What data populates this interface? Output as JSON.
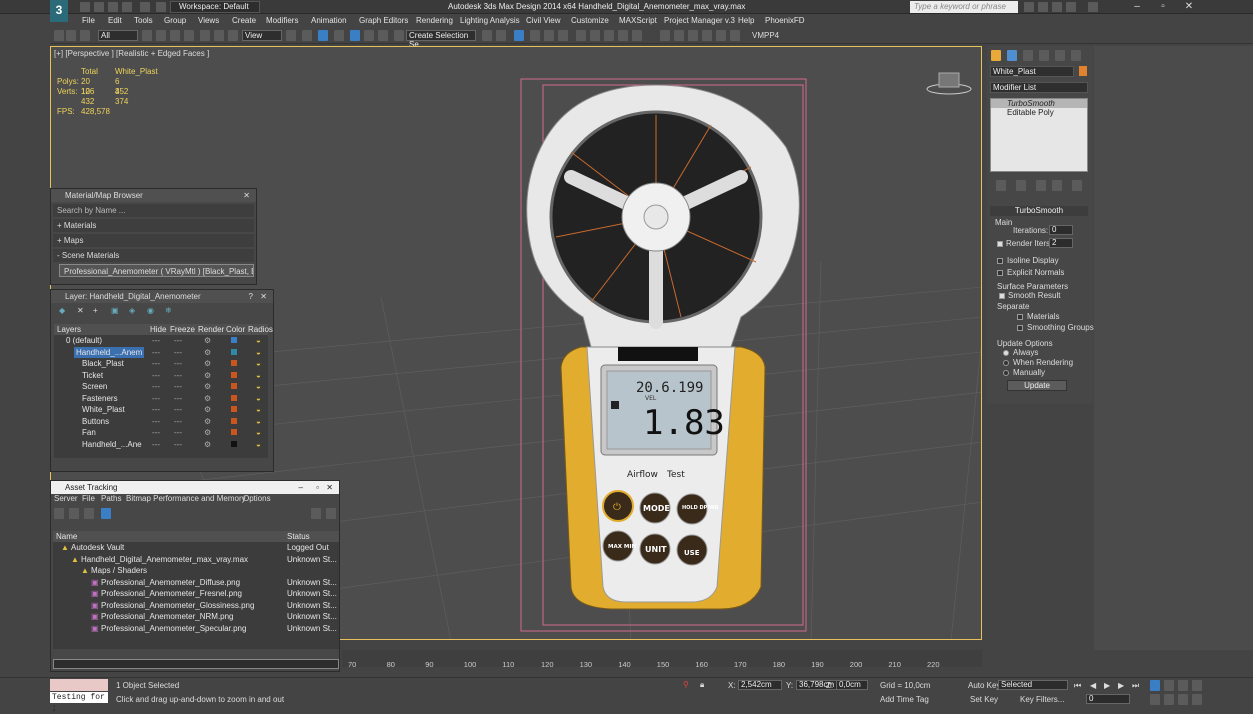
{
  "app": {
    "title": "Autodesk 3ds Max Design 2014 x64     Handheld_Digital_Anemometer_max_vray.max",
    "workspace": "Workspace: Default",
    "search_placeholder": "Type a keyword or phrase"
  },
  "menu": [
    "File",
    "Edit",
    "Tools",
    "Group",
    "Views",
    "Create",
    "Modifiers",
    "Animation",
    "Graph Editors",
    "Rendering",
    "Lighting Analysis",
    "Civil View",
    "Customize",
    "MAXScript",
    "Project Manager v.3",
    "Help",
    "PhoenixFD"
  ],
  "toolbar": {
    "filter": "All",
    "ref_coord": "View",
    "selection_set": "Create Selection Se",
    "vmpp": "VMPP4"
  },
  "viewport": {
    "label": "[+] [Perspective ] [Realistic + Edged Faces ]",
    "stats": {
      "h_total": "Total",
      "h_obj": "White_Plast",
      "polys_label": "Polys:",
      "polys_total": "20 126",
      "polys_obj": "6 452",
      "verts_label": "Verts:",
      "verts_total": "10 432",
      "verts_obj": "3 374",
      "fps_label": "FPS:",
      "fps": "428,578"
    },
    "device": {
      "lcd_top": "20.6.199",
      "lcd_unit": "VEL",
      "lcd_main": "1.83",
      "airflow": "Airflow",
      "test": "Test",
      "buttons": [
        "MODE",
        "HOLD DP/WB",
        "MAX MIN",
        "UNIT",
        "USE"
      ]
    }
  },
  "material_browser": {
    "title": "Material/Map Browser",
    "search": "Search by Name ...",
    "sections": [
      "+ Materials",
      "+ Maps",
      "- Scene Materials"
    ],
    "scene_material": "Professional_Anemometer ( VRayMtl ) [Black_Plast, B..."
  },
  "layer_manager": {
    "title": "Layer: Handheld_Digital_Anemometer",
    "columns": [
      "Layers",
      "Hide",
      "Freeze",
      "Render",
      "Color",
      "Radios"
    ],
    "rows": [
      {
        "name": "0 (default)",
        "color": "#3a7fc6",
        "indent": 0
      },
      {
        "name": "Handheld_...Anem",
        "color": "#2e8aa8",
        "indent": 1,
        "selected": true
      },
      {
        "name": "Black_Plast",
        "color": "#c8561e",
        "indent": 2
      },
      {
        "name": "Ticket",
        "color": "#c8561e",
        "indent": 2
      },
      {
        "name": "Screen",
        "color": "#c8561e",
        "indent": 2
      },
      {
        "name": "Fasteners",
        "color": "#c8561e",
        "indent": 2
      },
      {
        "name": "White_Plast",
        "color": "#c8561e",
        "indent": 2
      },
      {
        "name": "Buttons",
        "color": "#c8561e",
        "indent": 2
      },
      {
        "name": "Fan",
        "color": "#c8561e",
        "indent": 2
      },
      {
        "name": "Handheld_...Ane",
        "color": "#111111",
        "indent": 2
      }
    ]
  },
  "asset_tracking": {
    "title": "Asset Tracking",
    "menu": [
      "Server",
      "File",
      "Paths",
      "Bitmap Performance and Memory",
      "Options"
    ],
    "col_name": "Name",
    "col_status": "Status",
    "rows": [
      {
        "name": "Autodesk Vault",
        "status": "Logged Out",
        "indent": 0
      },
      {
        "name": "Handheld_Digital_Anemometer_max_vray.max",
        "status": "Unknown St...",
        "indent": 1
      },
      {
        "name": "Maps / Shaders",
        "status": "",
        "indent": 2
      },
      {
        "name": "Professional_Anemometer_Diffuse.png",
        "status": "Unknown St...",
        "indent": 3
      },
      {
        "name": "Professional_Anemometer_Fresnel.png",
        "status": "Unknown St...",
        "indent": 3
      },
      {
        "name": "Professional_Anemometer_Glossiness.png",
        "status": "Unknown St...",
        "indent": 3
      },
      {
        "name": "Professional_Anemometer_NRM.png",
        "status": "Unknown St...",
        "indent": 3
      },
      {
        "name": "Professional_Anemometer_Specular.png",
        "status": "Unknown St...",
        "indent": 3
      }
    ]
  },
  "command_panel": {
    "object_name": "White_Plast",
    "modifier_list": "Modifier List",
    "stack": [
      "TurboSmooth",
      "Editable Poly"
    ],
    "turbosmooth": {
      "title": "TurboSmooth",
      "main": "Main",
      "iterations_label": "Iterations:",
      "iterations": "0",
      "render_iters_label": "Render Iters:",
      "render_iters": "2",
      "isoline": "Isoline Display",
      "explicit": "Explicit Normals",
      "surface": "Surface Parameters",
      "smooth_result": "Smooth Result",
      "separate": "Separate",
      "materials": "Materials",
      "smoothing_groups": "Smoothing Groups",
      "update_options": "Update Options",
      "always": "Always",
      "when_rendering": "When Rendering",
      "manually": "Manually",
      "update_btn": "Update"
    }
  },
  "timeline": {
    "ticks": [
      "70",
      "80",
      "90",
      "100",
      "110",
      "120",
      "130",
      "140",
      "150",
      "160",
      "170",
      "180",
      "190",
      "200",
      "210",
      "220"
    ]
  },
  "status": {
    "maxscript": "Testing for ;",
    "selected": "1 Object Selected",
    "prompt": "Click and drag up-and-down to zoom in and out",
    "x_label": "X:",
    "x": "2,542cm",
    "y_label": "Y:",
    "y": "36,798cm",
    "z_label": "Z:",
    "z": "0,0cm",
    "grid": "Grid = 10,0cm",
    "add_time_tag": "Add Time Tag",
    "auto_key": "Auto Key",
    "set_key": "Set Key",
    "selected_dropdown": "Selected",
    "key_filters": "Key Filters...",
    "frame": "0"
  }
}
